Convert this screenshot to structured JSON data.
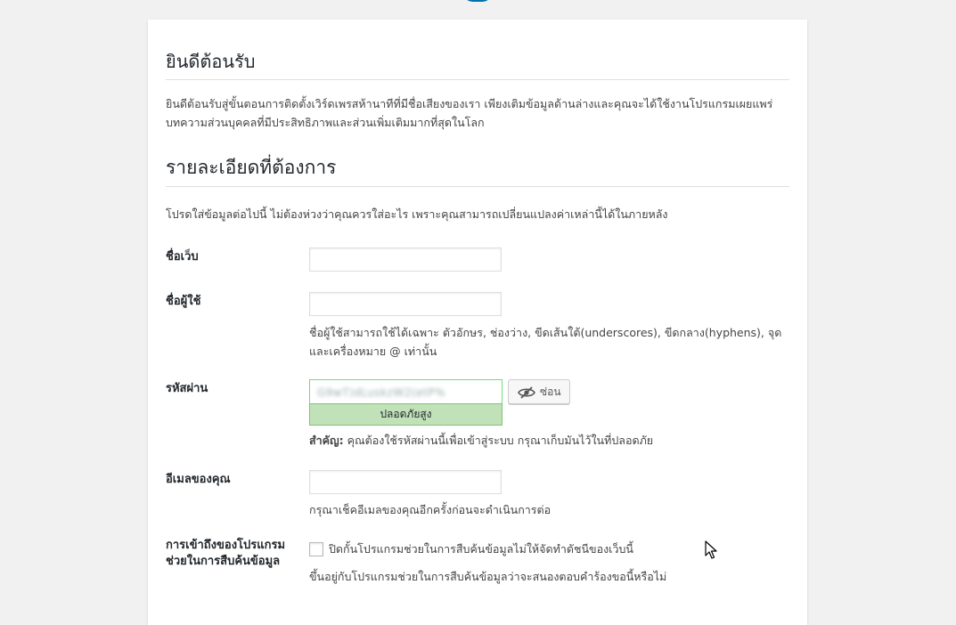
{
  "welcome": {
    "title": "ยินดีต้อนรับ",
    "text": "ยินดีต้อนรับสู่ขั้นตอนการติดตั้งเวิร์ดเพรสห้านาทีที่มีชื่อเสียงของเรา เพียงเติมข้อมูลด้านล่างและคุณจะได้ใช้งานโปรแกรมเผยแพร่บทความส่วนบุคคลที่มีประสิทธิภาพและส่วนเพิ่มเติมมากที่สุดในโลก"
  },
  "details": {
    "title": "รายละเอียดที่ต้องการ",
    "text": "โปรดใส่ข้อมูลต่อไปนี้ ไม่ต้องห่วงว่าคุณควรใส่อะไร เพราะคุณสามารถเปลี่ยนแปลงค่าเหล่านี้ได้ในภายหลัง"
  },
  "form": {
    "site_title_label": "ชื่อเว็บ",
    "site_title_value": "",
    "username_label": "ชื่อผู้ใช้",
    "username_value": "",
    "username_hint": "ชื่อผู้ใช้สามารถใช้ได้เฉพาะ ตัวอักษร, ช่องว่าง, ขีดเส้นใต้(underscores), ขีดกลาง(hyphens), จุดและเครื่องหมาย @ เท่านั้น",
    "password_label": "รหัสผ่าน",
    "password_value": "G9wT)dLuskzW2(etP%",
    "hide_button": "ซ่อน",
    "strength": "ปลอดภัยสูง",
    "important_prefix": "สำคัญ:",
    "important_text": " คุณต้องใช้รหัสผ่านนี้เพื่อเข้าสู่ระบบ กรุณาเก็บมันไว้ในที่ปลอดภัย",
    "email_label": "อีเมลของคุณ",
    "email_value": "",
    "email_hint": "กรุณาเช็คอีเมลของคุณอีกครั้งก่อนจะดำเนินการต่อ",
    "search_label": "การเข้าถึงของโปรแกรมช่วยในการสืบค้นข้อมูล",
    "search_checkbox_label": "ปิดกั้นโปรแกรมช่วยในการสืบค้นข้อมูลไม่ให้จัดทำดัชนีของเว็บนี้",
    "search_checked": false,
    "search_hint": "ขึ้นอยู่กับโปรแกรมช่วยในการสืบค้นข้อมูลว่าจะสนองตอบคำร้องขอนี้หรือไม่"
  },
  "colors": {
    "accent": "#0073aa",
    "strength_bg": "#c1e1b9",
    "strength_border": "#83c373"
  },
  "icons": {
    "hide": "eye-slash-icon",
    "cursor": "mouse-pointer-icon"
  }
}
